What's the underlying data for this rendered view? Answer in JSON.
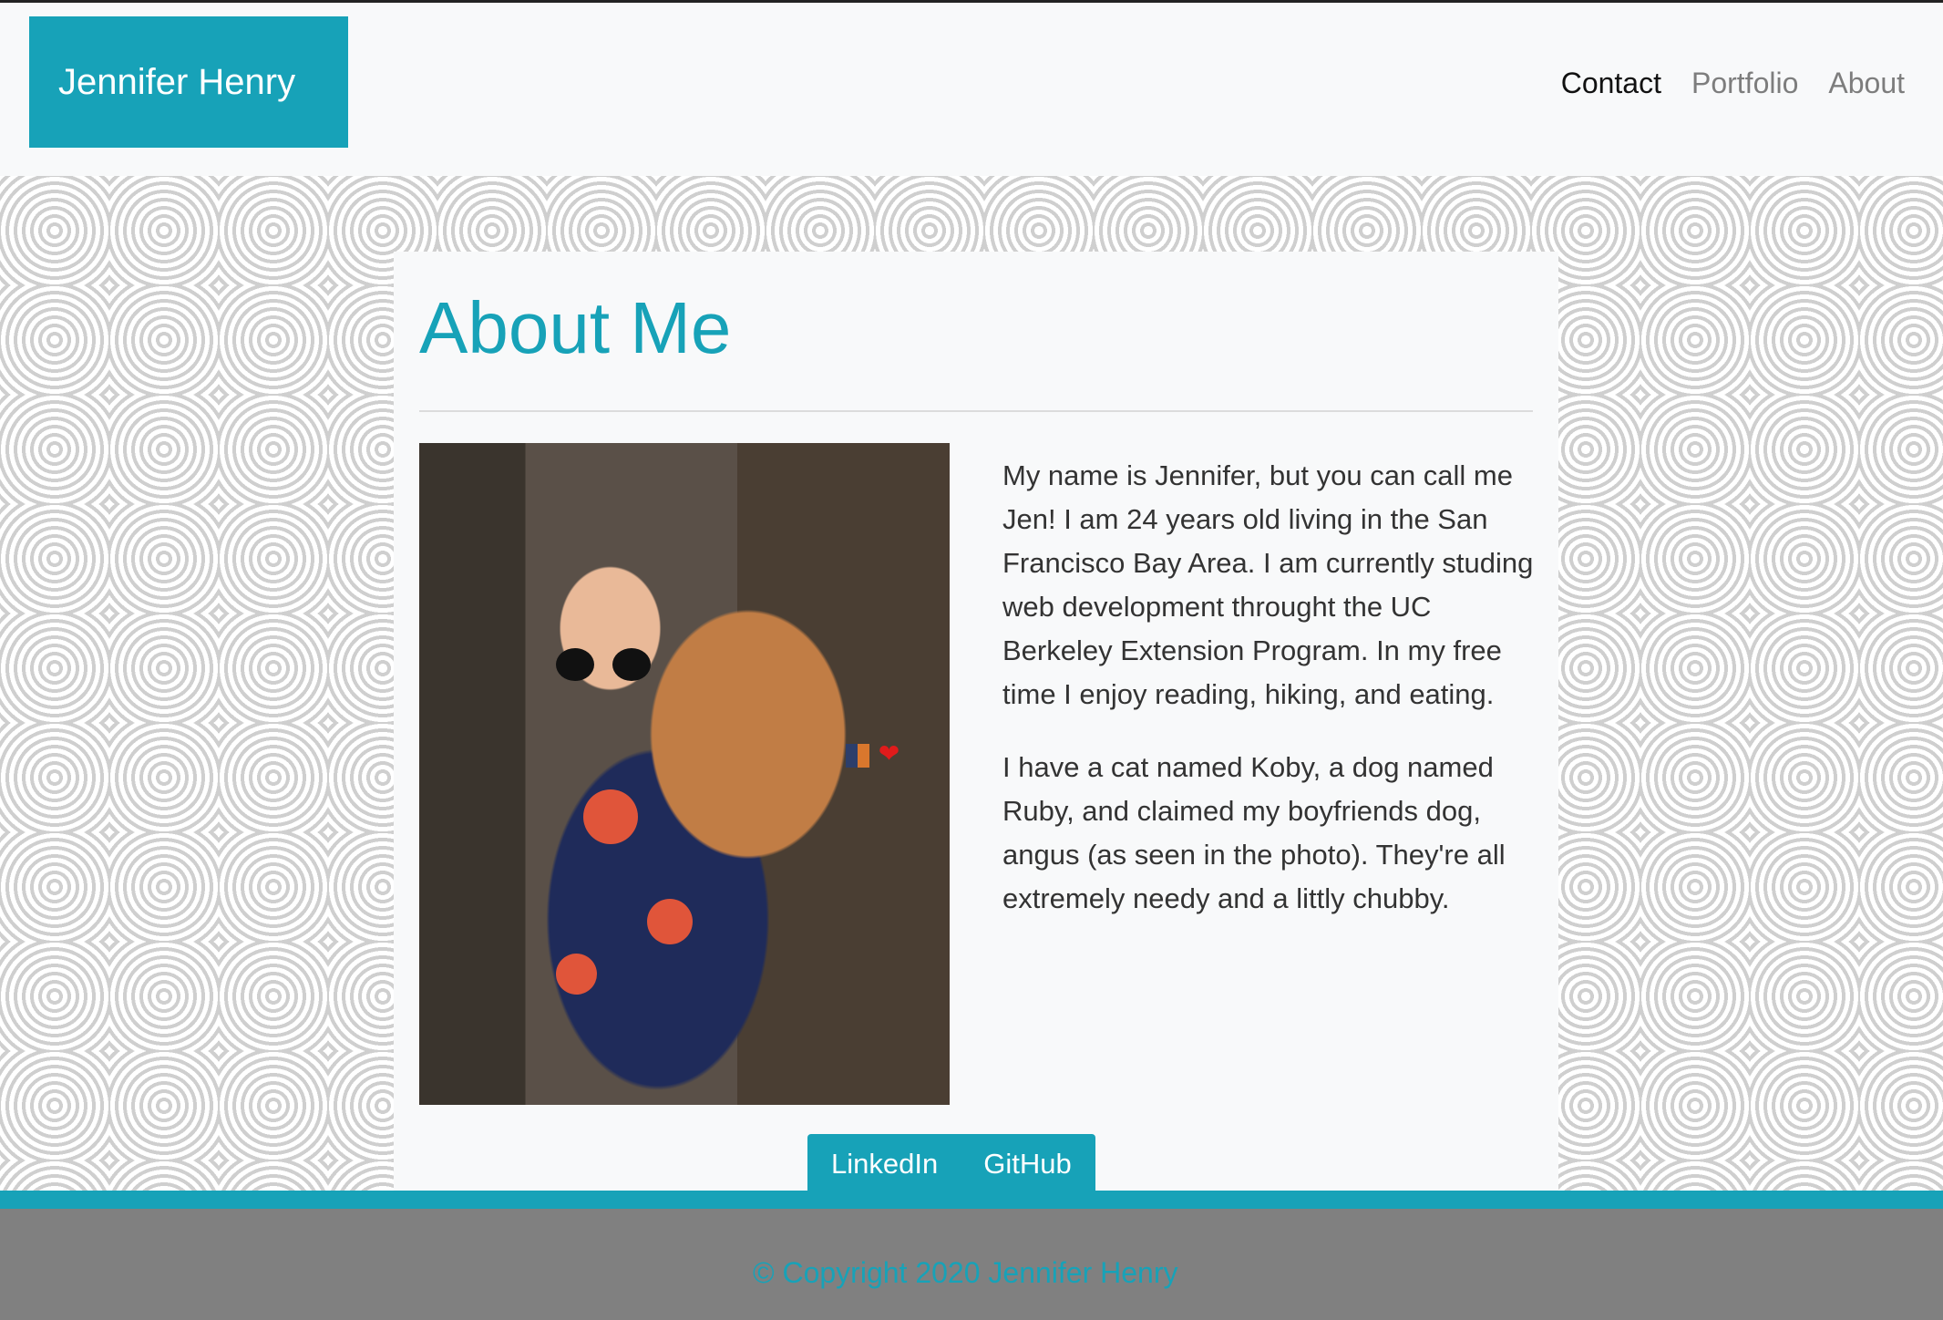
{
  "brand": {
    "name": "Jennifer Henry"
  },
  "nav": {
    "items": [
      {
        "label": "Contact"
      },
      {
        "label": "Portfolio"
      },
      {
        "label": "About"
      }
    ]
  },
  "about": {
    "title": "About Me",
    "paragraph_1": "My name is Jennifer, but you can call me Jen! I am 24 years old living in the San Francisco Bay Area. I am currently studing web development throught the UC Berkeley Extension Program. In my free time I enjoy reading, hiking, and eating.",
    "paragraph_2": "I have a cat named Koby, a dog named Ruby, and claimed my boyfriends dog, angus (as seen in the photo). They're all extremely needy and a littly chubby.",
    "emoji_text": "❤"
  },
  "social": {
    "linkedin_label": "LinkedIn",
    "github_label": "GitHub"
  },
  "footer": {
    "copyright": "© Copyright 2020 Jennifer Henry"
  },
  "colors": {
    "accent": "#17a2b8",
    "footer_bg": "#808080",
    "page_bg": "#f8f9fa"
  }
}
